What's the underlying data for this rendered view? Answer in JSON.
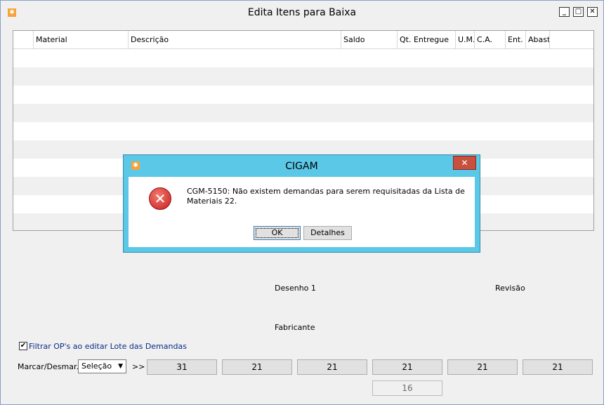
{
  "window": {
    "title": "Edita Itens para Baixa"
  },
  "grid": {
    "columns": [
      "",
      "Material",
      "Descrição",
      "Saldo",
      "Qt. Entregue",
      "U.M.",
      "C.A.",
      "Ent.",
      "Abast."
    ]
  },
  "form": {
    "desenho_label": "Desenho 1",
    "revisao_label": "Revisão",
    "fabricante_label": "Fabricante",
    "filter_checkbox_label": "Filtrar OP's ao editar Lote das Demandas",
    "filter_checked": true,
    "marcar_label": "Marcar/Desmar.",
    "selection_value": "Seleção",
    "arrows": ">>",
    "count_buttons": [
      "31",
      "21",
      "21",
      "21",
      "21",
      "21"
    ],
    "bottom_count": "16"
  },
  "dialog": {
    "title": "CIGAM",
    "message": "CGM-5150: Não existem demandas para serem requisitadas da Lista de Materiais 22.",
    "ok_label": "OK",
    "details_label": "Detalhes"
  }
}
